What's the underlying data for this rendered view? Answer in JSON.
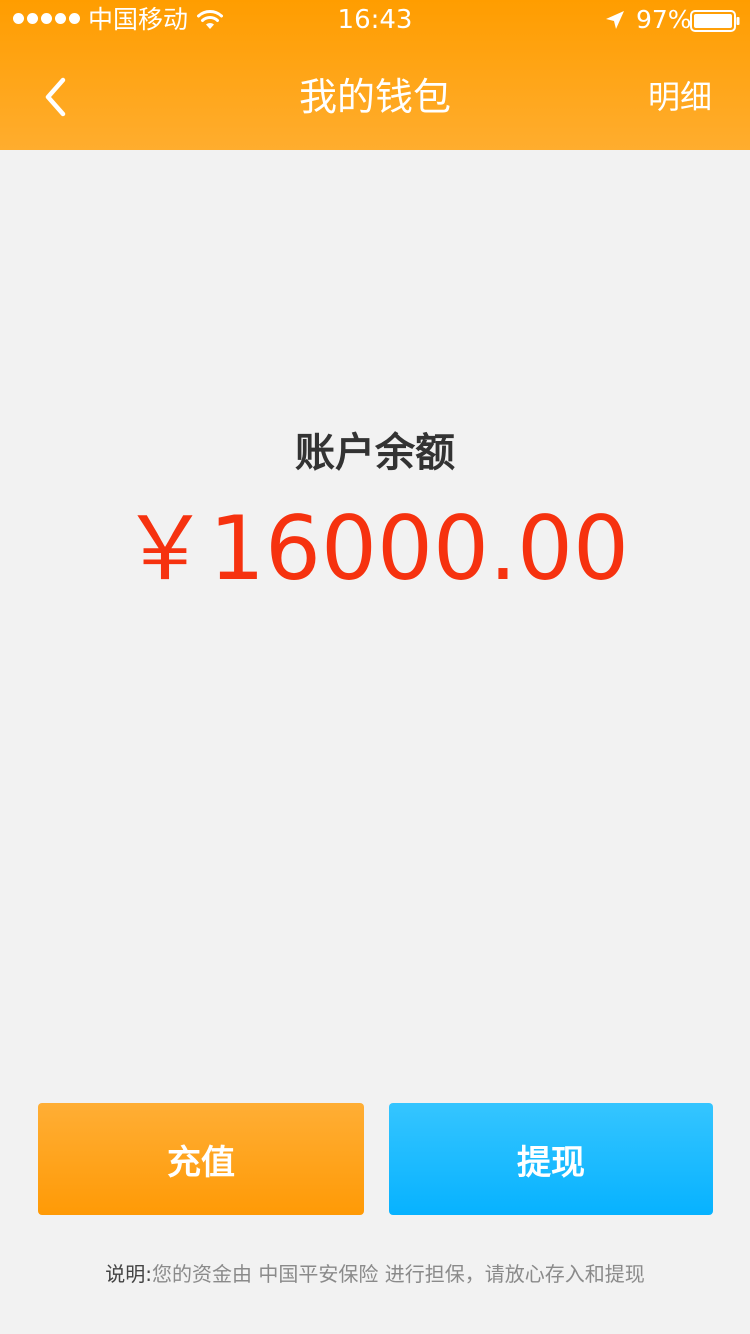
{
  "status_bar": {
    "carrier": "中国移动",
    "time": "16:43",
    "battery": "97%",
    "signal_icon": "signal-dots-icon",
    "wifi_icon": "wifi-icon",
    "location_icon": "location-arrow-icon",
    "battery_icon": "battery-icon"
  },
  "nav": {
    "title": "我的钱包",
    "detail_label": "明细",
    "back_icon": "chevron-left-icon"
  },
  "balance": {
    "label": "账户余额",
    "amount": "￥16000.00"
  },
  "actions": {
    "recharge_label": "充值",
    "withdraw_label": "提现"
  },
  "note": {
    "label": "说明:",
    "text": "您的资金由 中国平安保险 进行担保，请放心存入和提现"
  },
  "colors": {
    "header_orange": "#ff9d00",
    "amount_red": "#f6320f",
    "recharge_orange": "#ff9a06",
    "withdraw_blue": "#07b2ff",
    "background": "#f2f2f2"
  }
}
